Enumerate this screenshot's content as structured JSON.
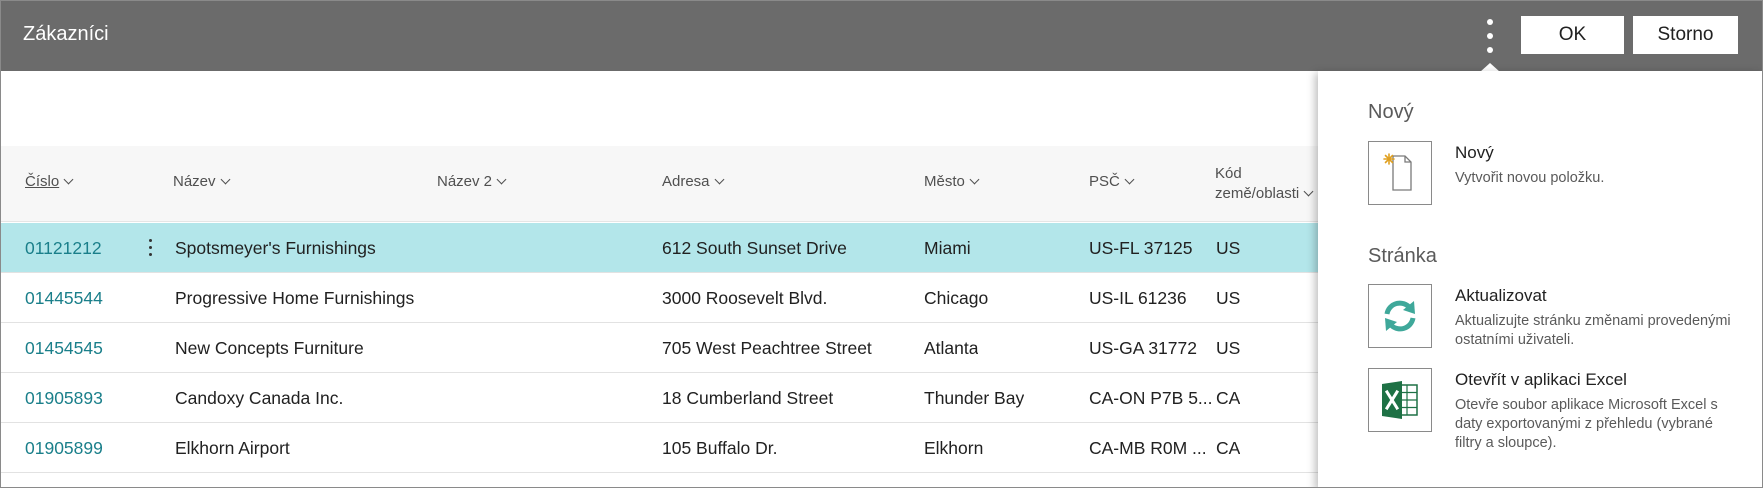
{
  "header": {
    "title": "Zákazníci",
    "ok_label": "OK",
    "cancel_label": "Storno"
  },
  "columns": {
    "cislo": "Číslo",
    "nazev": "Název",
    "nazev2": "Název 2",
    "adresa": "Adresa",
    "mesto": "Město",
    "psc": "PSČ",
    "kod_line1": "Kód",
    "kod_line2": "země/oblasti"
  },
  "rows": [
    {
      "cislo": "01121212",
      "nazev": "Spotsmeyer's Furnishings",
      "nazev2": "",
      "adresa": "612 South Sunset Drive",
      "mesto": "Miami",
      "psc": "US-FL 37125",
      "kod": "US",
      "selected": true
    },
    {
      "cislo": "01445544",
      "nazev": "Progressive Home Furnishings",
      "nazev2": "",
      "adresa": "3000 Roosevelt Blvd.",
      "mesto": "Chicago",
      "psc": "US-IL 61236",
      "kod": "US",
      "selected": false
    },
    {
      "cislo": "01454545",
      "nazev": "New Concepts Furniture",
      "nazev2": "",
      "adresa": "705 West Peachtree Street",
      "mesto": "Atlanta",
      "psc": "US-GA 31772",
      "kod": "US",
      "selected": false
    },
    {
      "cislo": "01905893",
      "nazev": "Candoxy Canada Inc.",
      "nazev2": "",
      "adresa": "18 Cumberland Street",
      "mesto": "Thunder Bay",
      "psc": "CA-ON P7B 5...",
      "kod": "CA",
      "selected": false
    },
    {
      "cislo": "01905899",
      "nazev": "Elkhorn Airport",
      "nazev2": "",
      "adresa": "105 Buffalo Dr.",
      "mesto": "Elkhorn",
      "psc": "CA-MB R0M ...",
      "kod": "CA",
      "selected": false
    }
  ],
  "menu": {
    "section_new": "Nový",
    "new_label": "Nový",
    "new_desc": "Vytvořit novou položku.",
    "section_page": "Stránka",
    "refresh_label": "Aktualizovat",
    "refresh_desc": "Aktualizujte stránku změnami provedenými ostatními uživateli.",
    "excel_label": "Otevřít v aplikaci Excel",
    "excel_desc": "Otevře soubor aplikace Microsoft Excel s daty exportovanými z přehledu (vybrané filtry a sloupce)."
  },
  "colors": {
    "header_bg": "#6b6b6b",
    "selected_row": "#b3e6ea",
    "link": "#1a7f8a",
    "excel_green": "#1e7145",
    "refresh_teal": "#3fa89a"
  },
  "icons": {
    "more": "more-vertical-icon",
    "new": "new-document-icon",
    "refresh": "refresh-icon",
    "excel": "excel-icon",
    "sort": "chevron-down-icon"
  }
}
